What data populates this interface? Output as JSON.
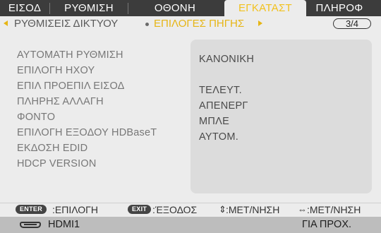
{
  "tabs": [
    {
      "label": "ΕΙΣΟΔ",
      "active": false
    },
    {
      "label": "ΡΥΘΜΙΣΗ",
      "active": false
    },
    {
      "label": "ΟΘΟΝΗ",
      "active": false
    },
    {
      "label": "ΕΓΚΑΤΑΣΤ",
      "active": true
    },
    {
      "label": "ΠΛΗΡΟΦ",
      "active": false
    }
  ],
  "subnav": {
    "network_settings": "ΡΥΘΜΙΣΕΙΣ ΔΙΚΤΥΟΥ",
    "source_options": "ΕΠΙΛΟΓΕΣ ΠΗΓΗΣ",
    "page": "3/4"
  },
  "settings": [
    {
      "label": "ΑΥΤΟΜΑΤΗ ΡΥΘΜΙΣΗ",
      "value": "ΚΑΝΟΝΙΚΗ"
    },
    {
      "label": "ΕΠΙΛΟΓΗ ΗΧΟΥ",
      "value": ""
    },
    {
      "label": "ΕΠΙΛ ΠΡΟΕΠΙΛ ΕΙΣΟΔ",
      "value": "ΤΕΛΕΥΤ."
    },
    {
      "label": "ΠΛΗΡΗΣ ΑΛΛΑΓΗ",
      "value": "ΑΠΕΝΕΡΓ"
    },
    {
      "label": "ΦΟΝΤΟ",
      "value": "ΜΠΛΕ"
    },
    {
      "label": "ΕΠΙΛΟΓΗ ΕΞΟΔΟΥ HDBaseT",
      "value": "ΑΥΤΟΜ."
    },
    {
      "label": "ΕΚΔΟΣΗ EDID",
      "value": ""
    },
    {
      "label": "HDCP VERSION",
      "value": ""
    }
  ],
  "help": {
    "enter_key": "ENTER",
    "enter_label": ":ΕΠΙΛΟΓΗ",
    "exit_key": "EXIT",
    "exit_label": ":ΈΞΟΔΟΣ",
    "updown_icon": "up-down-arrows-icon",
    "updown_label": ":ΜΕΤ/ΝΗΣΗ",
    "leftright_icon": "left-right-arrows-icon",
    "leftright_label": ":ΜΕΤ/ΝΗΣΗ"
  },
  "status": {
    "input_icon": "hdmi-port-icon",
    "input": "HDMI1",
    "mode": "ΓΙΑ ΠΡΟΧ."
  },
  "colors": {
    "active_tab_text": "#f2c11d",
    "tab_bar": "#3c3c3c",
    "subnav_active": "#e6b515"
  }
}
